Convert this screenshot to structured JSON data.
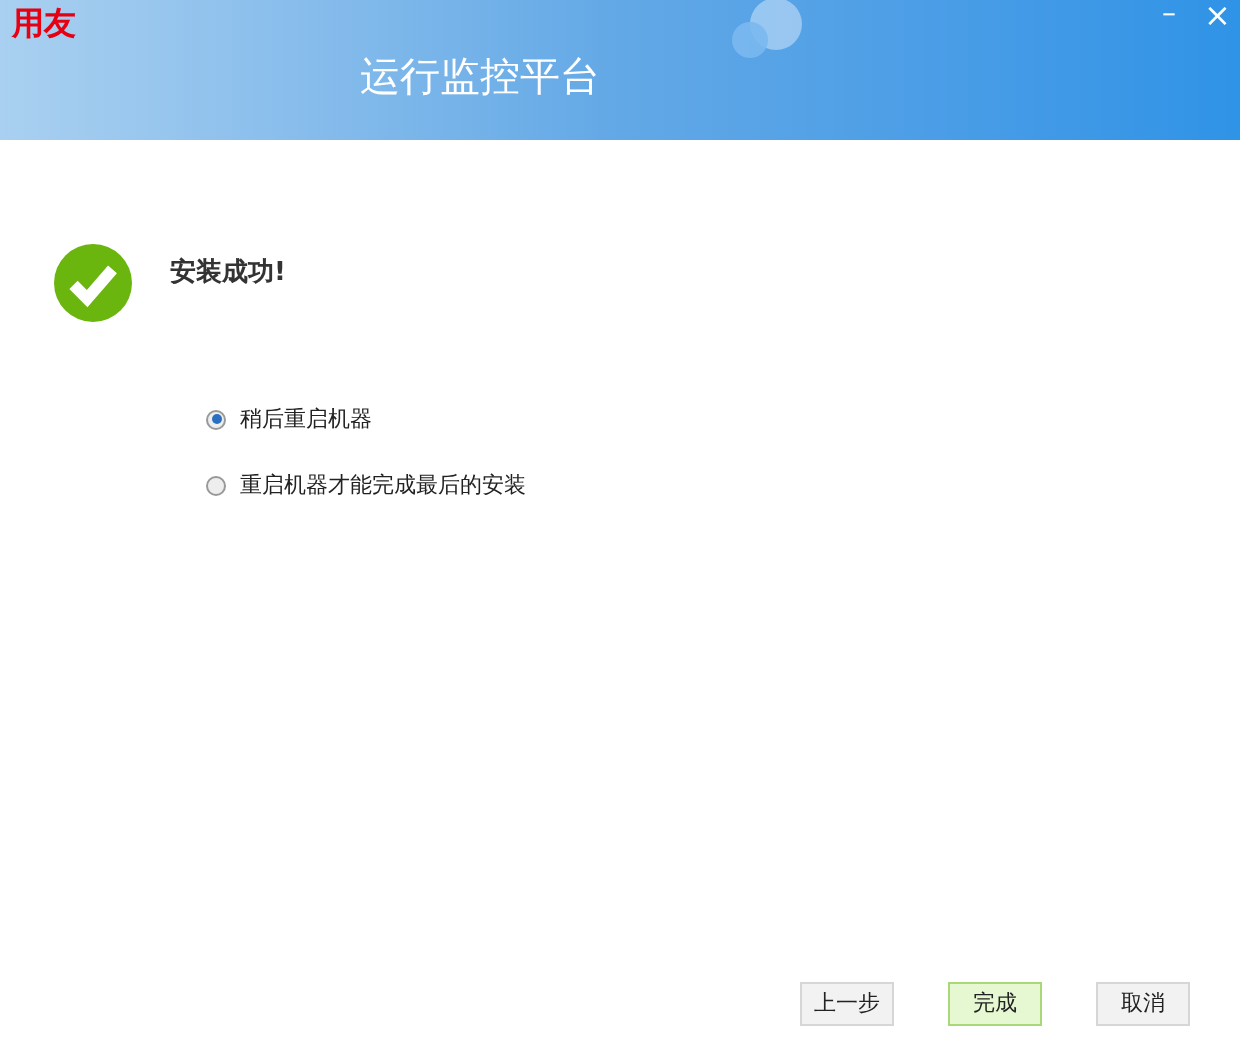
{
  "window": {
    "logo": "用友",
    "title": "运行监控平台",
    "minimize": "–",
    "close": "×"
  },
  "status": {
    "title": "安装成功!"
  },
  "options": [
    {
      "label": "稍后重启机器",
      "selected": true
    },
    {
      "label": "重启机器才能完成最后的安装",
      "selected": false
    }
  ],
  "buttons": [
    {
      "label": "上一步",
      "primary": false
    },
    {
      "label": "完成",
      "primary": true
    },
    {
      "label": "取消",
      "primary": false
    }
  ]
}
